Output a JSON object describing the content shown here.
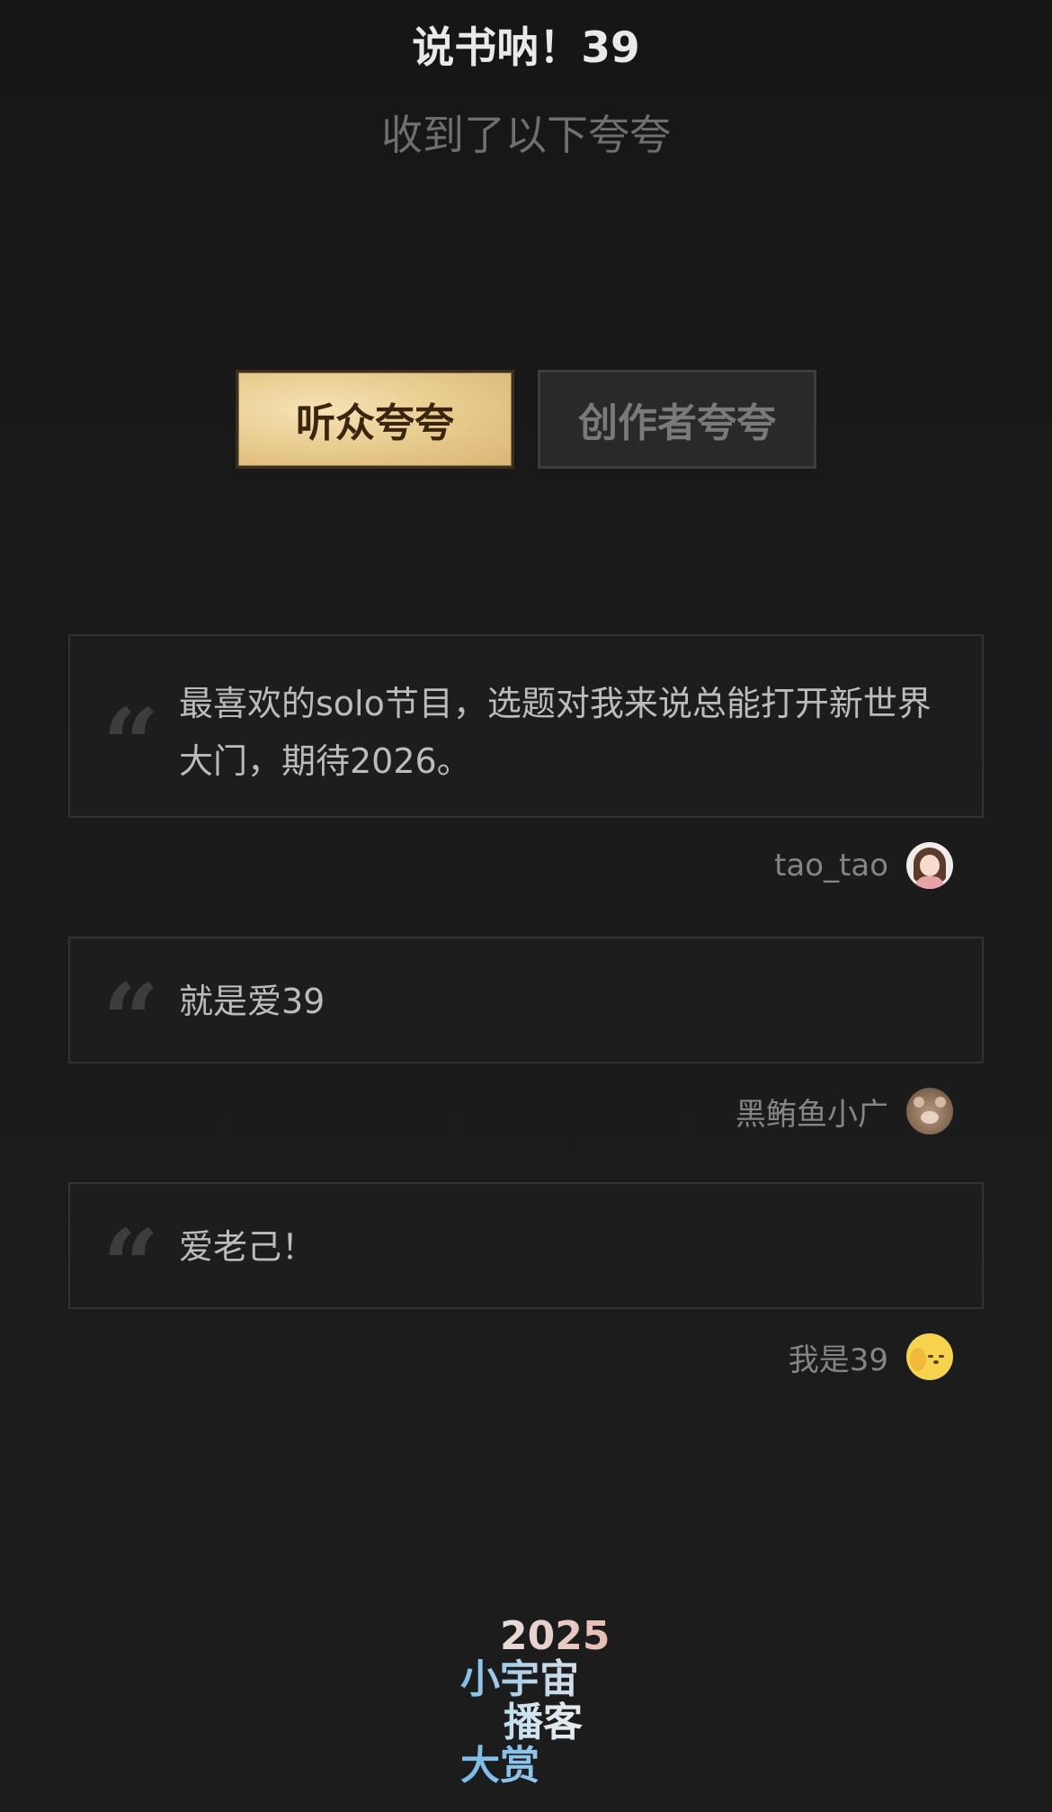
{
  "header": {
    "title": "说书呐！39",
    "subtitle": "收到了以下夸夸"
  },
  "tabs": [
    {
      "label": "听众夸夸",
      "active": true
    },
    {
      "label": "创作者夸夸",
      "active": false
    }
  ],
  "comments": [
    {
      "text": "最喜欢的solo节目，选题对我来说总能打开新世界大门，期待2026。",
      "author": "tao_tao"
    },
    {
      "text": "就是爱39",
      "author": "黑鲔鱼小广"
    },
    {
      "text": "爱老己！",
      "author": "我是39"
    }
  ],
  "logo": {
    "line1": "2025",
    "line2": "小宇宙",
    "line3": "播客",
    "line4": "大赏"
  },
  "icons": {
    "quote": "quote-icon",
    "avatar": "avatar"
  }
}
